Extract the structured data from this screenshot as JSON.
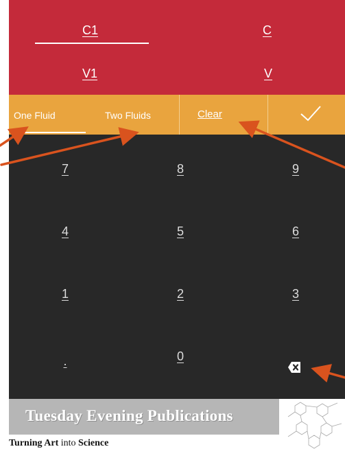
{
  "inputs": {
    "c1_label": "C1",
    "c_label": "C",
    "v1_label": "V1",
    "v_label": "V"
  },
  "mode_bar": {
    "tab_one": "One Fluid",
    "tab_two": "Two Fluids",
    "clear_label": "Clear",
    "selected_tab": "One Fluid",
    "confirm_icon": "checkmark-icon"
  },
  "keypad": {
    "keys": [
      "7",
      "8",
      "9",
      "4",
      "5",
      "6",
      "1",
      "2",
      "3",
      ".",
      "0"
    ],
    "backspace_icon": "backspace-icon"
  },
  "banner": {
    "title": "Tuesday Evening Publications",
    "tagline_part1": "Turning Art",
    "tagline_part2": " into ",
    "tagline_part3": "Science"
  },
  "colors": {
    "red_panel": "#c42a3a",
    "orange_bar": "#e9a43e",
    "keypad_bg": "#282828",
    "arrow": "#d9531e"
  }
}
